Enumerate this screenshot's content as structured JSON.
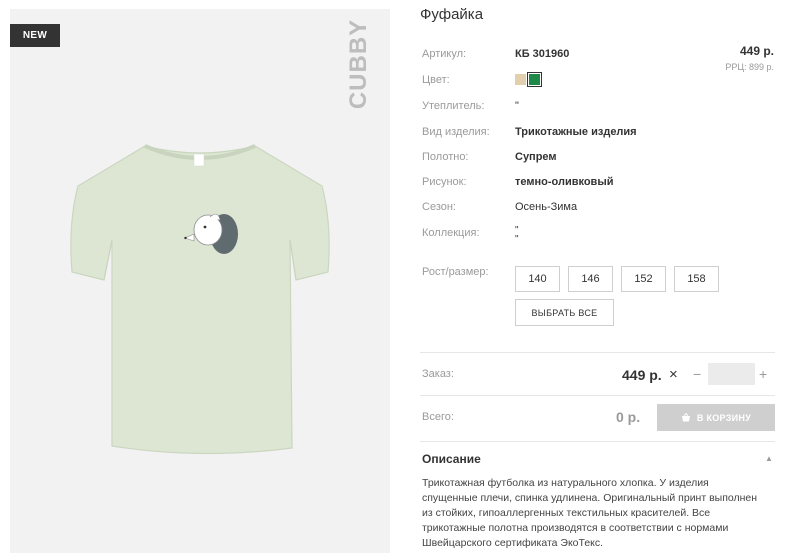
{
  "gallery": {
    "badge": "NEW",
    "brand": "CUBBY"
  },
  "product": {
    "title": "Фуфайка",
    "price": "449 р.",
    "rrp": "РРЦ: 899 р."
  },
  "attributes": [
    {
      "label": "Артикул:",
      "value": "КБ 301960"
    },
    {
      "label": "Цвет:"
    },
    {
      "label": "Утеплитель:",
      "value": "\""
    },
    {
      "label": "Вид изделия:",
      "value": "Трикотажные изделия"
    },
    {
      "label": "Полотно:",
      "value": "Супрем"
    },
    {
      "label": "Рисунок:",
      "value": "темно-оливковый"
    },
    {
      "label": "Сезон:",
      "value": "Осень-Зима"
    },
    {
      "label": "Коллекция:",
      "value": "\"\n\""
    }
  ],
  "colors": [
    {
      "name": "beige",
      "hex": "#e2cfae",
      "selected": false
    },
    {
      "name": "green",
      "hex": "#1f8a47",
      "selected": true
    }
  ],
  "sizes": {
    "label": "Рост/размер:",
    "options": [
      "140",
      "146",
      "152",
      "158"
    ],
    "select_all": "ВЫБРАТЬ ВСЕ"
  },
  "order": {
    "label": "Заказ:",
    "price": "449 р.",
    "times": "×",
    "minus": "−",
    "plus": "+",
    "quantity": ""
  },
  "total": {
    "label": "Всего:",
    "value": "0 р.",
    "cart_button": "В КОРЗИНУ"
  },
  "description": {
    "heading": "Описание",
    "text": "Трикотажная футболка из натурального хлопка. У изделия спущенные плечи, спинка удлинена. Оригинальный принт выполнен из стойких, гипоаллергенных текстильных красителей. Все трикотажные полотна производятся в соответствии с нормами Швейцарского сертификата ЭкоТекс."
  }
}
